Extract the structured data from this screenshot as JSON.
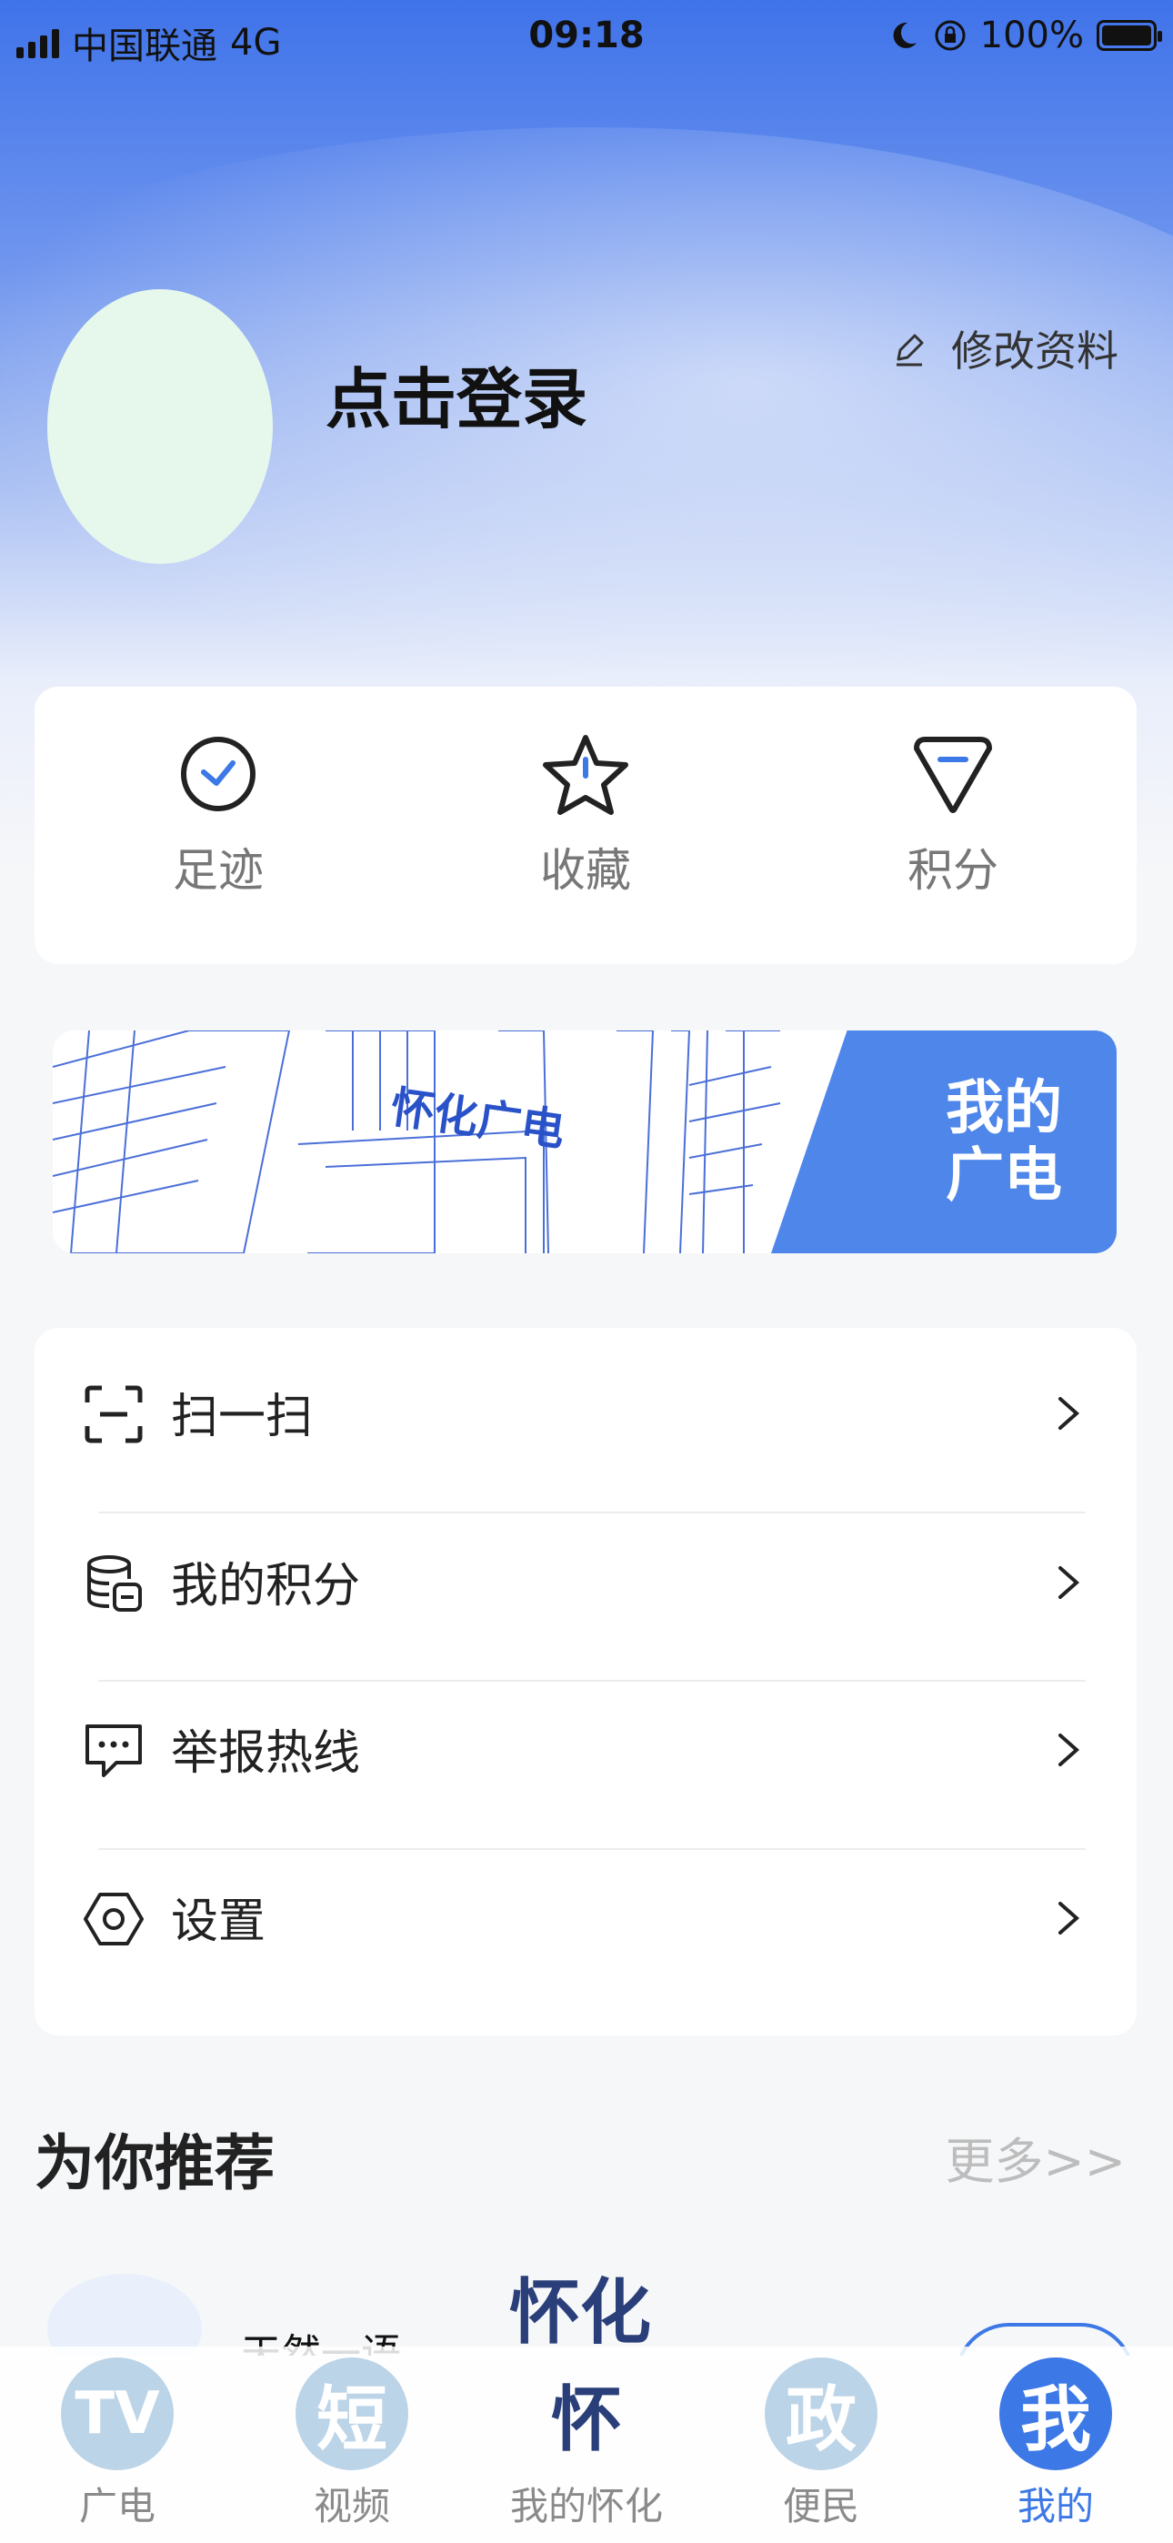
{
  "status": {
    "carrier": "中国联通",
    "network": "4G",
    "time": "09:18",
    "battery": "100%"
  },
  "profile": {
    "login_text": "点击登录",
    "edit_text": "修改资料"
  },
  "quick": [
    {
      "label": "足迹",
      "icon": "footprint-check-icon"
    },
    {
      "label": "收藏",
      "icon": "star-icon"
    },
    {
      "label": "积分",
      "icon": "points-diamond-icon"
    }
  ],
  "banner": {
    "sign_text": "怀化广电",
    "tag_line1": "我的",
    "tag_line2": "广电"
  },
  "menu": [
    {
      "label": "扫一扫",
      "icon": "scan-icon"
    },
    {
      "label": "我的积分",
      "icon": "coins-database-icon"
    },
    {
      "label": "举报热线",
      "icon": "message-report-icon"
    },
    {
      "label": "设置",
      "icon": "settings-hexagon-icon"
    }
  ],
  "recommend": {
    "title": "为你推荐",
    "more": "更多>>",
    "item2_text": "天然一语",
    "item3_logo": "怀化"
  },
  "tabs": [
    {
      "glyph": "TV",
      "label": "广电",
      "active": false
    },
    {
      "glyph": "短",
      "label": "视频",
      "active": false
    },
    {
      "glyph": "怀",
      "label": "我的怀化",
      "active": false
    },
    {
      "glyph": "政",
      "label": "便民",
      "active": false
    },
    {
      "glyph": "我",
      "label": "我的",
      "active": true
    }
  ],
  "colors": {
    "accent": "#3c78e6",
    "hero_top": "#3f73ea",
    "inactive_tab": "#bcd4e8"
  }
}
